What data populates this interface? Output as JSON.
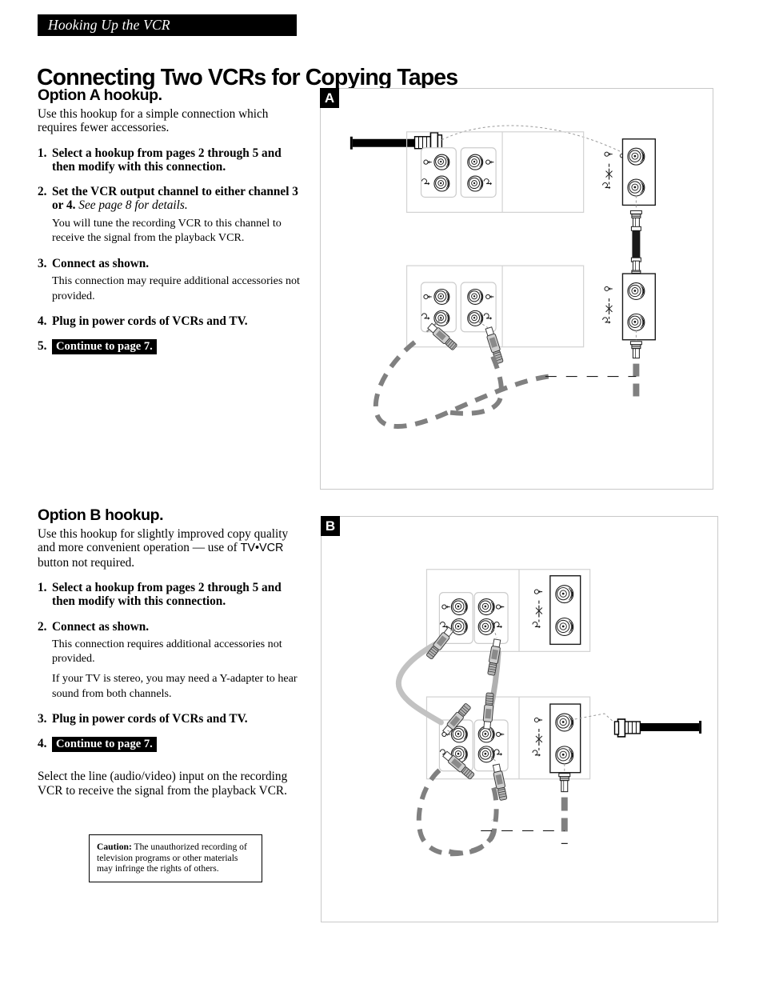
{
  "running_head": "Hooking Up the VCR",
  "page_title": "Connecting Two VCRs for Copying Tapes",
  "option_a": {
    "heading": "Option A hookup.",
    "intro": "Use this hookup for a simple connection which requires fewer accessories.",
    "steps": [
      {
        "num": "1.",
        "main": "Select a hookup from pages 2 through 5 and then modify with this connection.",
        "subs": []
      },
      {
        "num": "2.",
        "main": "Set the VCR output channel to either channel 3 or 4.",
        "main_italic": "See page 8 for details.",
        "subs": [
          "You will tune the recording VCR to this channel to receive the signal from the playback VCR."
        ]
      },
      {
        "num": "3.",
        "main": "Connect as shown.",
        "subs": [
          "This connection may require additional accessories not provided."
        ]
      },
      {
        "num": "4.",
        "main": "Plug in power cords of VCRs and TV.",
        "subs": []
      },
      {
        "num": "5.",
        "tag": "Continue to page 7.",
        "subs": []
      }
    ]
  },
  "option_b": {
    "heading": "Option B hookup.",
    "intro_part1": "Use this hookup for slightly improved copy quality and more convenient operation — use of ",
    "intro_sans": "TV•VCR",
    "intro_part2": " button not required.",
    "steps": [
      {
        "num": "1.",
        "main": "Select a hookup from pages 2 through 5 and then modify with this connection.",
        "subs": []
      },
      {
        "num": "2.",
        "main": "Connect as shown.",
        "subs": [
          "This connection requires additional accessories not provided.",
          "If your TV is stereo, you may need a Y-adapter to hear sound from both channels."
        ]
      },
      {
        "num": "3.",
        "main": "Plug in power cords of VCRs and TV.",
        "subs": []
      },
      {
        "num": "4.",
        "tag": "Continue to page 7.",
        "subs": []
      }
    ],
    "tail": "Select the line (audio/video) input on the recording VCR to receive the signal from the playback VCR."
  },
  "caution": {
    "label": "Caution:",
    "text": " The unauthorized recording of television programs or other materials may infringe the rights of others."
  },
  "figures": {
    "panel_a_badge": "A",
    "panel_b_badge": "B"
  },
  "colors": {
    "ink": "#000000",
    "panel_border": "#c9c9c9",
    "cable_gray": "#808080",
    "light_cable": "#b8b8b8",
    "device_outline": "#d0d0d0"
  }
}
